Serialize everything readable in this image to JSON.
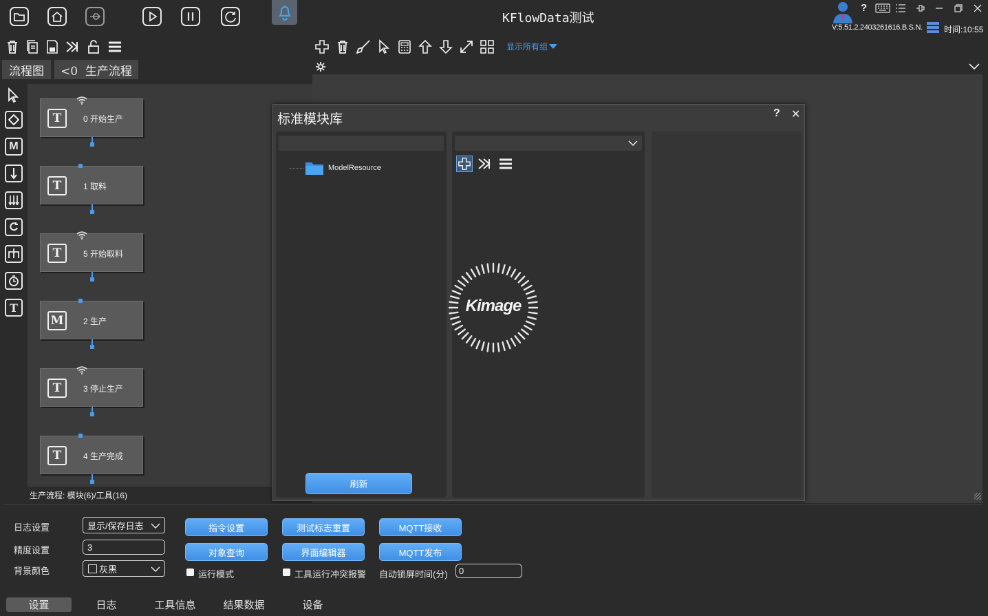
{
  "app": {
    "title": "KFlowData测试",
    "version": "V:5.51.2.2403261616.B.S.N.",
    "time": "时间:10:55"
  },
  "left_tabs": {
    "flow": "流程图",
    "prod": "<0  生产流程"
  },
  "toolbar2": {
    "show_groups": "显示所有组"
  },
  "nodes": [
    {
      "label": "0  开始生产",
      "icon": "T",
      "marker": "wifi"
    },
    {
      "label": "1  取料",
      "icon": "T",
      "marker": "dot"
    },
    {
      "label": "5 开始取料",
      "icon": "T",
      "marker": "wifi"
    },
    {
      "label": "2 生产",
      "icon": "M",
      "marker": "dot"
    },
    {
      "label": "3 停止生产",
      "icon": "T",
      "marker": "wifi"
    },
    {
      "label": "4 生产完成",
      "icon": "T",
      "marker": "dot"
    }
  ],
  "canvas_status": "生产流程: 模块(6)/工具(16)",
  "dialog": {
    "title": "标准模块库",
    "help": "?",
    "close": "✕",
    "tree_item": "ModelResource",
    "refresh": "刷新",
    "loading_logo": "Kimage"
  },
  "settings": {
    "log_label": "日志设置",
    "log_value": "显示/保存日志",
    "precision_label": "精度设置",
    "precision_value": "3",
    "bg_label": "背景颜色",
    "bg_value": "灰黑",
    "cmd_btn": "指令设置",
    "obj_btn": "对象查询",
    "run_mode": "运行模式",
    "reset_btn": "测试标志重置",
    "ui_btn": "界面编辑器",
    "conflict": "工具运行冲突报警",
    "mqtt_recv": "MQTT接收",
    "mqtt_pub": "MQTT发布",
    "lock_label": "自动锁屏时间(分)",
    "lock_value": "0"
  },
  "bottom_tabs": [
    "设置",
    "日志",
    "工具信息",
    "结果数据",
    "设备"
  ],
  "colors": {
    "accent": "#4a9be8",
    "bg": "#2b2b2b",
    "panel": "#3c3c3c",
    "bell": "#4a90c8"
  }
}
